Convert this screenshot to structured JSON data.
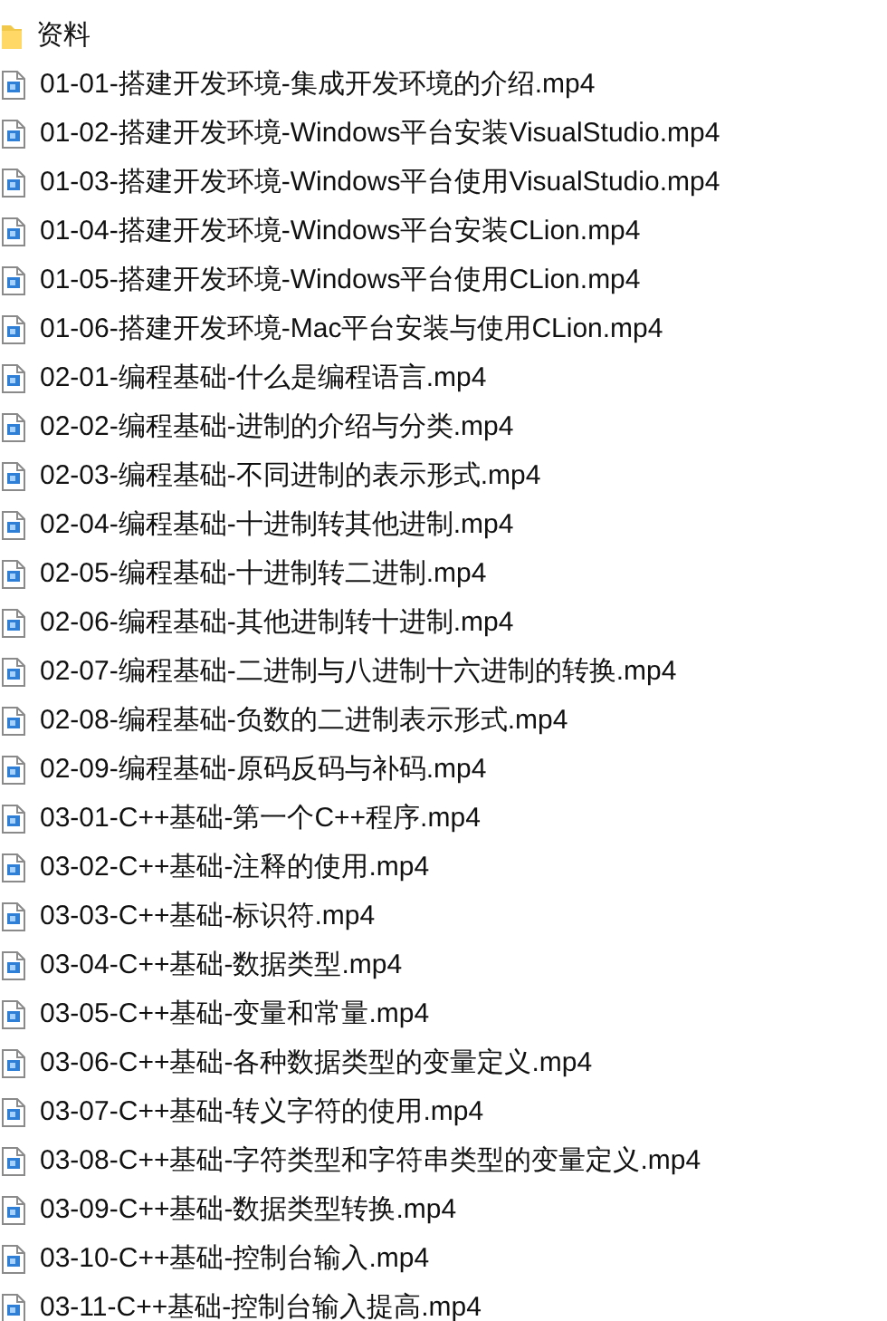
{
  "files": [
    {
      "kind": "folder",
      "name": "资料"
    },
    {
      "kind": "video",
      "name": "01-01-搭建开发环境-集成开发环境的介绍.mp4"
    },
    {
      "kind": "video",
      "name": "01-02-搭建开发环境-Windows平台安装VisualStudio.mp4"
    },
    {
      "kind": "video",
      "name": "01-03-搭建开发环境-Windows平台使用VisualStudio.mp4"
    },
    {
      "kind": "video",
      "name": "01-04-搭建开发环境-Windows平台安装CLion.mp4"
    },
    {
      "kind": "video",
      "name": "01-05-搭建开发环境-Windows平台使用CLion.mp4"
    },
    {
      "kind": "video",
      "name": "01-06-搭建开发环境-Mac平台安装与使用CLion.mp4"
    },
    {
      "kind": "video",
      "name": "02-01-编程基础-什么是编程语言.mp4"
    },
    {
      "kind": "video",
      "name": "02-02-编程基础-进制的介绍与分类.mp4"
    },
    {
      "kind": "video",
      "name": "02-03-编程基础-不同进制的表示形式.mp4"
    },
    {
      "kind": "video",
      "name": "02-04-编程基础-十进制转其他进制.mp4"
    },
    {
      "kind": "video",
      "name": "02-05-编程基础-十进制转二进制.mp4"
    },
    {
      "kind": "video",
      "name": "02-06-编程基础-其他进制转十进制.mp4"
    },
    {
      "kind": "video",
      "name": "02-07-编程基础-二进制与八进制十六进制的转换.mp4"
    },
    {
      "kind": "video",
      "name": "02-08-编程基础-负数的二进制表示形式.mp4"
    },
    {
      "kind": "video",
      "name": "02-09-编程基础-原码反码与补码.mp4"
    },
    {
      "kind": "video",
      "name": "03-01-C++基础-第一个C++程序.mp4"
    },
    {
      "kind": "video",
      "name": "03-02-C++基础-注释的使用.mp4"
    },
    {
      "kind": "video",
      "name": "03-03-C++基础-标识符.mp4"
    },
    {
      "kind": "video",
      "name": "03-04-C++基础-数据类型.mp4"
    },
    {
      "kind": "video",
      "name": "03-05-C++基础-变量和常量.mp4"
    },
    {
      "kind": "video",
      "name": "03-06-C++基础-各种数据类型的变量定义.mp4"
    },
    {
      "kind": "video",
      "name": "03-07-C++基础-转义字符的使用.mp4"
    },
    {
      "kind": "video",
      "name": "03-08-C++基础-字符类型和字符串类型的变量定义.mp4"
    },
    {
      "kind": "video",
      "name": "03-09-C++基础-数据类型转换.mp4"
    },
    {
      "kind": "video",
      "name": "03-10-C++基础-控制台输入.mp4"
    },
    {
      "kind": "video",
      "name": "03-11-C++基础-控制台输入提高.mp4"
    }
  ]
}
